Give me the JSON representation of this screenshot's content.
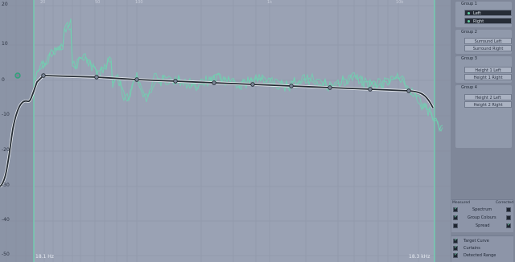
{
  "plot": {
    "y_ticks": [
      "20",
      "10",
      "0",
      "-10",
      "-20",
      "-30",
      "-40",
      "-50"
    ],
    "x_ticks": [
      "20",
      "50",
      "100",
      "1k",
      "10k"
    ],
    "low_freq_label": "18.1 Hz",
    "high_freq_label": "18.3 kHz",
    "colors": {
      "curve": "#262d35",
      "spectrum": "#6fd2b0",
      "marker": "#2fa37a",
      "grid": "#8b93a6"
    }
  },
  "groups": [
    {
      "title": "Group 1",
      "channels": [
        {
          "label": "Left",
          "selected": true
        },
        {
          "label": "Right",
          "selected": true
        }
      ]
    },
    {
      "title": "Group 2",
      "channels": [
        {
          "label": "Surround Left",
          "selected": false
        },
        {
          "label": "Surround Right",
          "selected": false
        }
      ]
    },
    {
      "title": "Group 3",
      "channels": [
        {
          "label": "Height 1 Left",
          "selected": false
        },
        {
          "label": "Height 1 Right",
          "selected": false
        }
      ]
    },
    {
      "title": "Group 4",
      "channels": [
        {
          "label": "Height 2 Left",
          "selected": false
        },
        {
          "label": "Height 2 Right",
          "selected": false
        }
      ]
    }
  ],
  "display_options": {
    "measured_header": "Measured",
    "corrected_header": "Corrected",
    "rows": [
      {
        "label": "Spectrum",
        "measured": true,
        "corrected": false
      },
      {
        "label": "Group Colours",
        "measured": true,
        "corrected": false
      },
      {
        "label": "Spread",
        "measured": false,
        "corrected": true
      }
    ]
  },
  "curve_options": [
    {
      "label": "Target Curve",
      "checked": true
    },
    {
      "label": "Curtains",
      "checked": true
    },
    {
      "label": "Detected Range",
      "checked": true
    }
  ]
}
